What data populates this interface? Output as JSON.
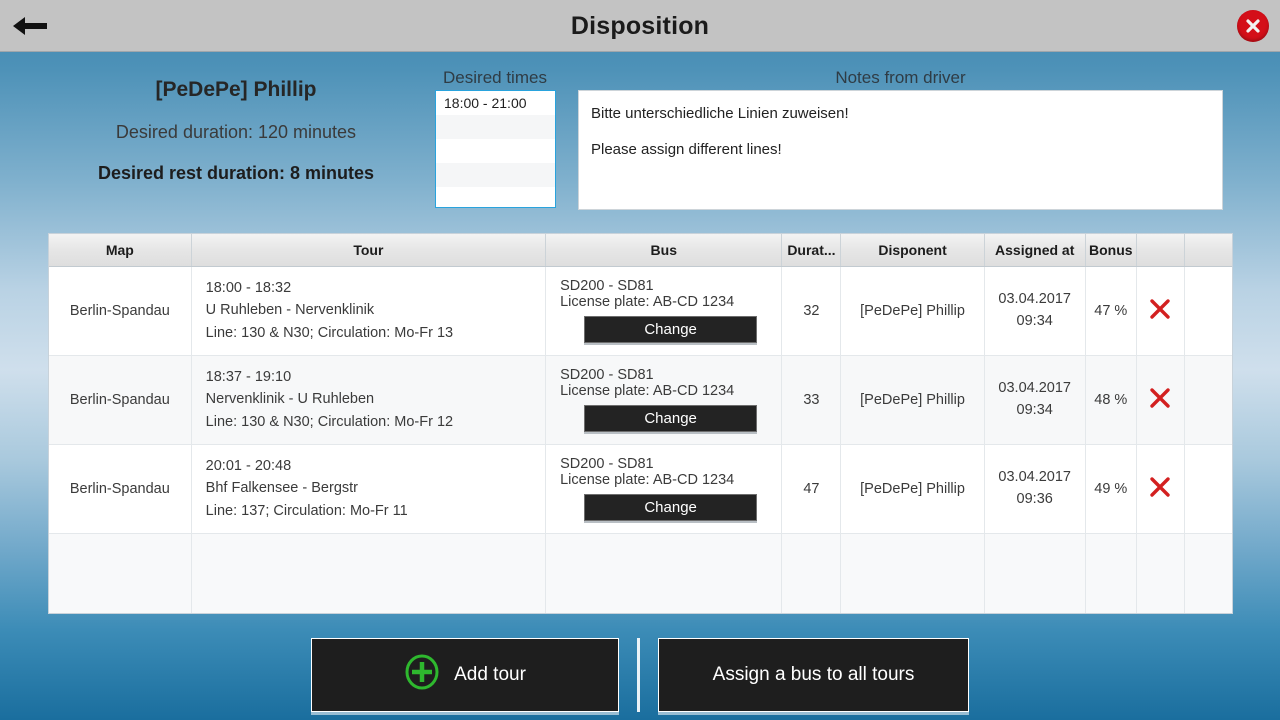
{
  "titlebar": {
    "back_icon": "back-arrow-icon",
    "title": "Disposition",
    "close_icon": "close-icon"
  },
  "driver": {
    "name": "[PeDePe] Phillip",
    "desired_duration": "Desired duration: 120 minutes",
    "desired_rest_duration": "Desired rest duration: 8 minutes"
  },
  "desired_times": {
    "label": "Desired times",
    "items": [
      "18:00 - 21:00"
    ]
  },
  "notes": {
    "label": "Notes from driver",
    "lines": [
      "Bitte unterschiedliche Linien zuweisen!",
      "Please assign different lines!"
    ]
  },
  "table": {
    "columns": [
      "Map",
      "Tour",
      "Bus",
      "Durat...",
      "Disponent",
      "Assigned at",
      "Bonus",
      "",
      ""
    ],
    "rows": [
      {
        "map": "Berlin-Spandau",
        "tour_time": "18:00 - 18:32",
        "tour_route": "U Ruhleben - Nervenklinik",
        "tour_line": "Line: 130 & N30; Circulation: Mo-Fr 13",
        "bus_model": "SD200 - SD81",
        "bus_plate": "License plate: AB-CD 1234",
        "change_label": "Change",
        "duration": "32",
        "disponent": "[PeDePe] Phillip",
        "assigned_date": "03.04.2017",
        "assigned_time": "09:34",
        "bonus": "47 %",
        "delete_icon": "delete-x-icon"
      },
      {
        "map": "Berlin-Spandau",
        "tour_time": "18:37 - 19:10",
        "tour_route": "Nervenklinik - U Ruhleben",
        "tour_line": "Line: 130 & N30; Circulation: Mo-Fr 12",
        "bus_model": "SD200 - SD81",
        "bus_plate": "License plate: AB-CD 1234",
        "change_label": "Change",
        "duration": "33",
        "disponent": "[PeDePe] Phillip",
        "assigned_date": "03.04.2017",
        "assigned_time": "09:34",
        "bonus": "48 %",
        "delete_icon": "delete-x-icon"
      },
      {
        "map": "Berlin-Spandau",
        "tour_time": "20:01 - 20:48",
        "tour_route": "Bhf Falkensee - Bergstr",
        "tour_line": "Line: 137; Circulation: Mo-Fr 11",
        "bus_model": "SD200 - SD81",
        "bus_plate": "License plate: AB-CD 1234",
        "change_label": "Change",
        "duration": "47",
        "disponent": "[PeDePe] Phillip",
        "assigned_date": "03.04.2017",
        "assigned_time": "09:36",
        "bonus": "49 %",
        "delete_icon": "delete-x-icon"
      }
    ]
  },
  "footer": {
    "add_tour_label": "Add tour",
    "add_tour_icon": "plus-circle-icon",
    "assign_all_label": "Assign a bus to all tours"
  },
  "colors": {
    "accent_blue": "#29a3dd",
    "close_red": "#d40f19",
    "delete_red": "#d32020",
    "plus_green": "#2eb82e",
    "button_dark": "#1e1e1e",
    "titlebar_gray": "#c3c3c3"
  }
}
